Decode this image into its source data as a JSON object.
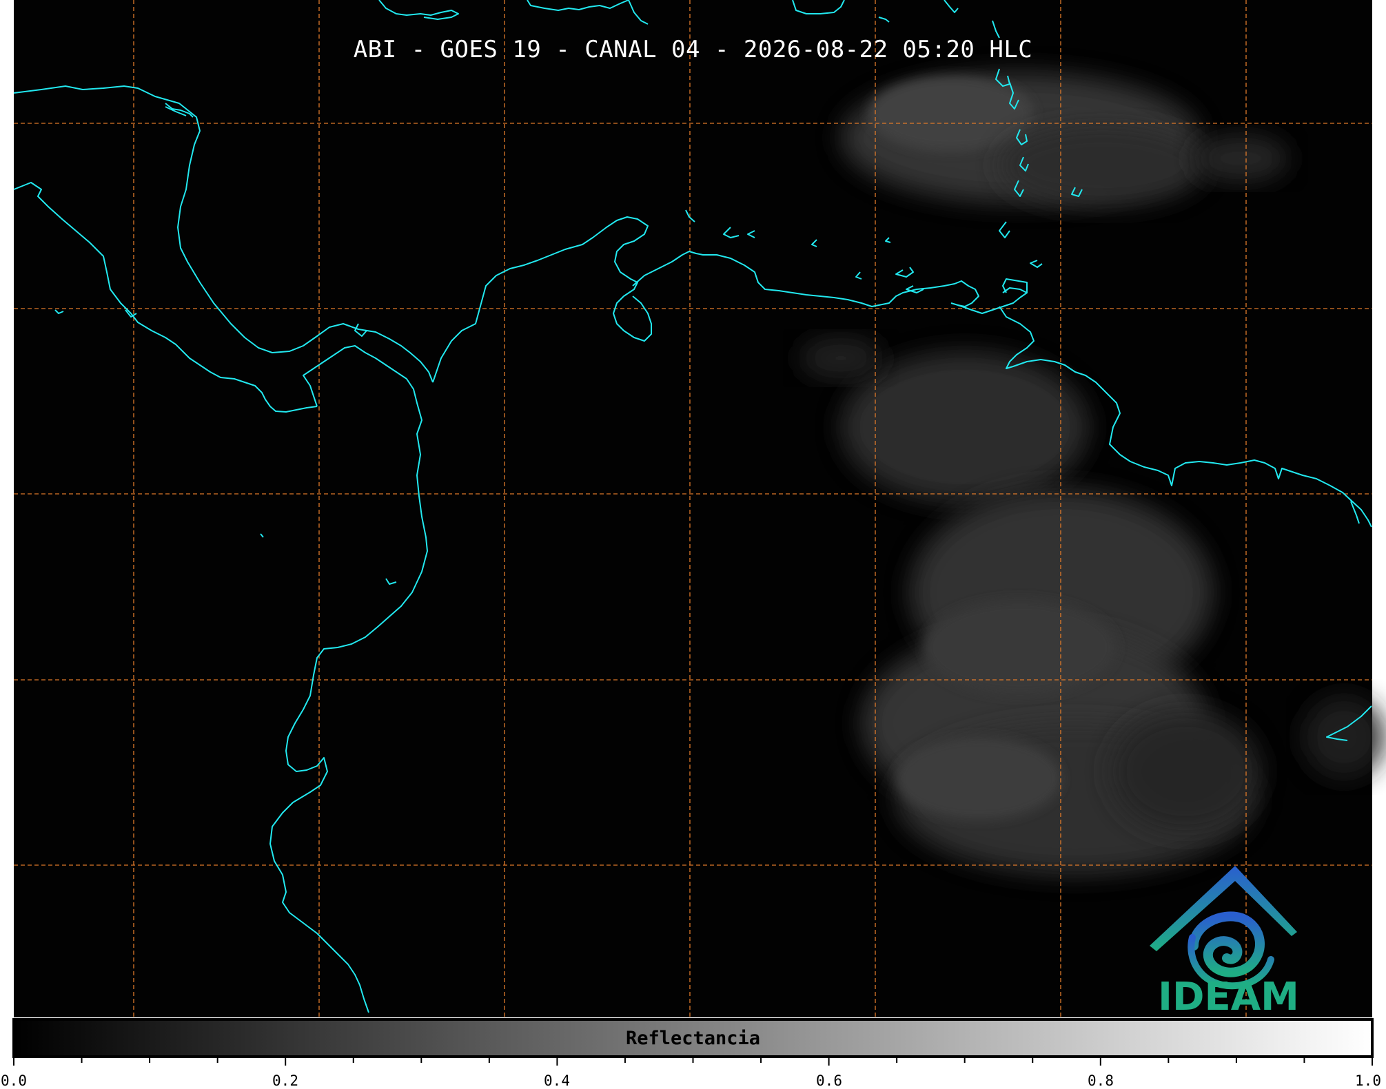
{
  "title": "ABI - GOES 19 - CANAL 04 - 2026-08-22 05:20 HLC",
  "colors": {
    "background": "#020202",
    "coastline": "#22e8ef",
    "grid": "#e07a2a",
    "cloud": "#3c3c3c",
    "logo_blue": "#2a78c8",
    "logo_green": "#1fae84"
  },
  "colorbar": {
    "label": "Reflectancia",
    "min": 0.0,
    "max": 1.0,
    "tick_labels": [
      "0.0",
      "0.2",
      "0.4",
      "0.6",
      "0.8",
      "1.0"
    ]
  },
  "logo": {
    "text": "IDEAM"
  }
}
